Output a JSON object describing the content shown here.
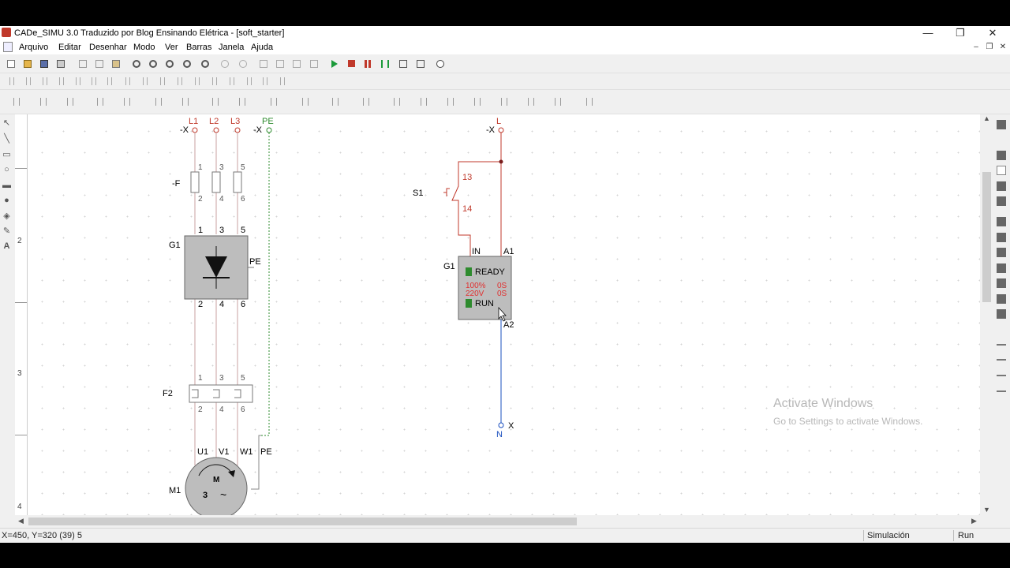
{
  "window": {
    "title": "CADe_SIMU 3.0 Traduzido por Blog Ensinando Elétrica - [soft_starter]",
    "minimize": "—",
    "restore": "❐",
    "close": "✕"
  },
  "menu": {
    "items": [
      "Arquivo",
      "Editar",
      "Desenhar",
      "Modo",
      "Ver",
      "Barras",
      "Janela",
      "Ajuda"
    ],
    "mdi_minimize": "–",
    "mdi_restore": "❐",
    "mdi_close": "✕"
  },
  "ruler": {
    "rows": [
      "2",
      "3",
      "4"
    ]
  },
  "schematic": {
    "power": {
      "phases": [
        "L1",
        "L2",
        "L3",
        "PE"
      ],
      "terminal_x": "-X",
      "terminal_x_pe": "-X",
      "fuse_label": "-F",
      "pins_top": [
        "1",
        "3",
        "5"
      ],
      "pins_bottom": [
        "2",
        "4",
        "6"
      ],
      "softstarter_label": "G1",
      "softstarter_pe": "PE",
      "relay_label": "F2",
      "motor_terminals": [
        "U1",
        "V1",
        "W1",
        "PE"
      ],
      "motor_label": "M1",
      "motor_m": "M",
      "motor_3": "3",
      "motor_tilde": "~"
    },
    "control": {
      "line_label": "L",
      "terminal_x": "-X",
      "switch_label": "S1",
      "switch_pin_top": "13",
      "switch_pin_bottom": "14",
      "module_label": "G1",
      "pin_in": "IN",
      "pin_a1": "A1",
      "pin_a2": "A2",
      "ready": "READY",
      "param1_a": "100%",
      "param1_b": "0S",
      "param2_a": "220V",
      "param2_b": "0S",
      "run": "RUN",
      "neutral_x": "X",
      "neutral_label": "N"
    },
    "colors": {
      "wire_power": "#c9a0a0",
      "wire_neutral": "#1a4fbf",
      "pe_wire": "#4caf50",
      "label_red": "#c0392b",
      "led_green": "#2e8b2e"
    }
  },
  "watermark": {
    "line1": "Activate Windows",
    "line2": "Go to Settings to activate Windows."
  },
  "status": {
    "coords": "X=450, Y=320 (39) 5",
    "mode": "Simulación",
    "run": "Run"
  }
}
